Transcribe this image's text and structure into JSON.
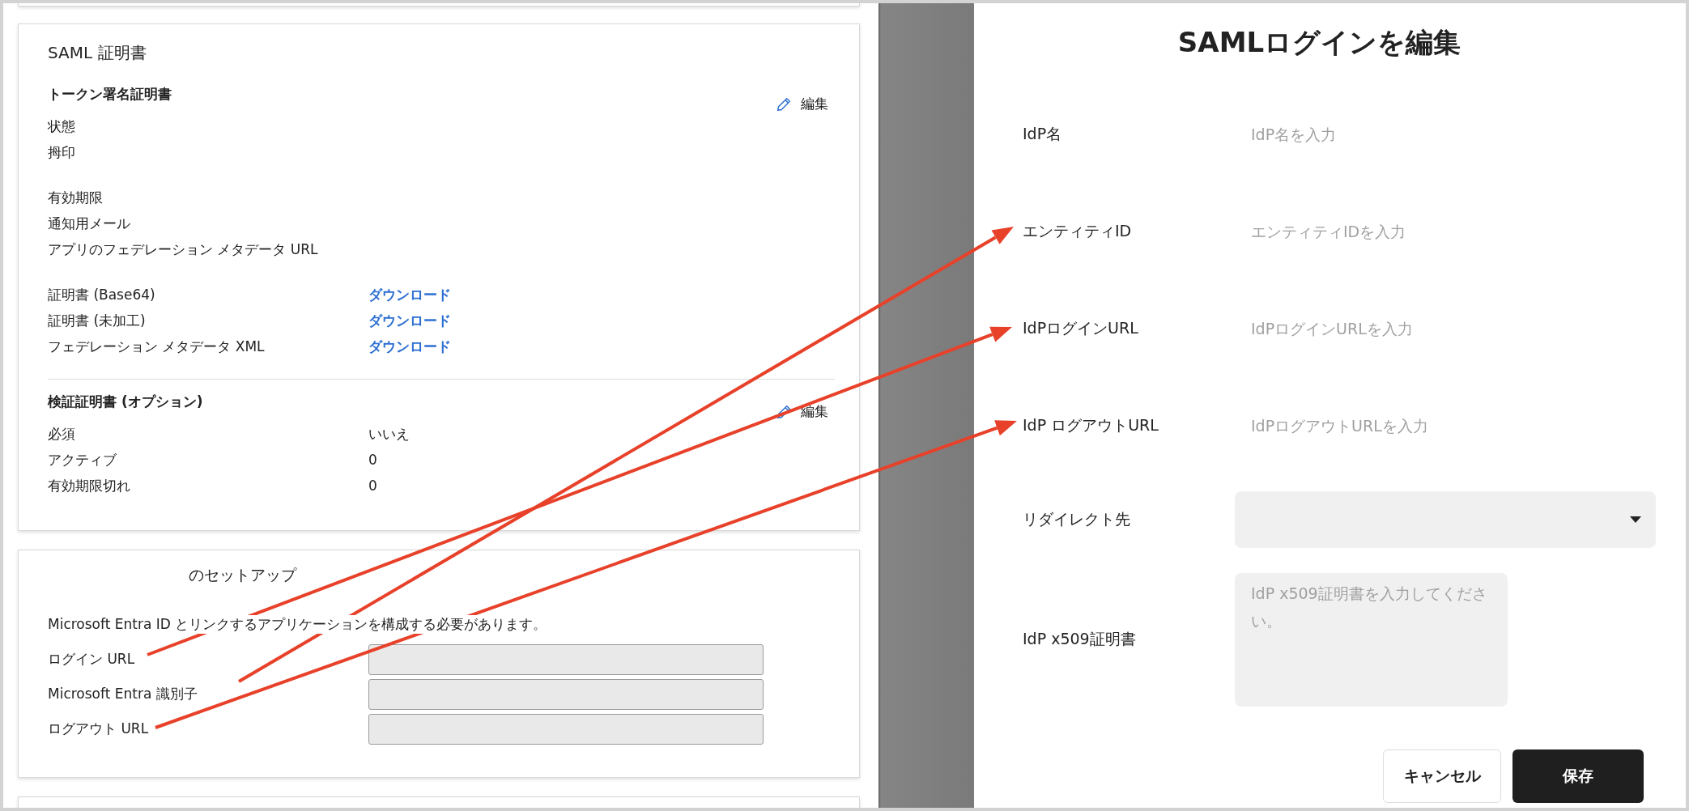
{
  "certificate_card": {
    "title": "SAML 証明書",
    "sections": [
      {
        "heading": "トークン署名証明書",
        "edit_label": "編集",
        "groups": [
          [
            {
              "label": "状態"
            },
            {
              "label": "拇印"
            }
          ],
          [
            {
              "label": "有効期限"
            },
            {
              "label": "通知用メール"
            },
            {
              "label": "アプリのフェデレーション メタデータ URL"
            }
          ],
          [
            {
              "label": "証明書 (Base64)",
              "link": "ダウンロード"
            },
            {
              "label": "証明書 (未加工)",
              "link": "ダウンロード"
            },
            {
              "label": "フェデレーション メタデータ XML",
              "link": "ダウンロード"
            }
          ]
        ]
      },
      {
        "heading": "検証証明書 (オプション)",
        "edit_label": "編集",
        "groups": [
          [
            {
              "label": "必須",
              "value": "いいえ"
            },
            {
              "label": "アクティブ",
              "value": "0"
            },
            {
              "label": "有効期限切れ",
              "value": "0"
            }
          ]
        ]
      }
    ]
  },
  "setup_card": {
    "title": "のセットアップ",
    "description": "Microsoft Entra ID とリンクするアプリケーションを構成する必要があります。",
    "fields": [
      {
        "label": "ログイン URL"
      },
      {
        "label": "Microsoft Entra 識別子"
      },
      {
        "label": "ログアウト URL"
      }
    ]
  },
  "dialog": {
    "title": "SAMLログインを編集",
    "fields": [
      {
        "kind": "text",
        "label": "IdP名",
        "placeholder": "IdP名を入力"
      },
      {
        "kind": "text",
        "label": "エンティティID",
        "placeholder": "エンティティIDを入力"
      },
      {
        "kind": "text",
        "label": "IdPログインURL",
        "placeholder": "IdPログインURLを入力"
      },
      {
        "kind": "text",
        "label": "IdP ログアウトURL",
        "placeholder": "IdPログアウトURLを入力"
      },
      {
        "kind": "select",
        "label": "リダイレクト先"
      },
      {
        "kind": "textarea",
        "label": "IdP x509証明書",
        "placeholder": "IdP x509証明書を入力してください。"
      }
    ],
    "buttons": [
      {
        "kind": "secondary",
        "label": "キャンセル"
      },
      {
        "kind": "primary",
        "label": "保存"
      }
    ]
  }
}
